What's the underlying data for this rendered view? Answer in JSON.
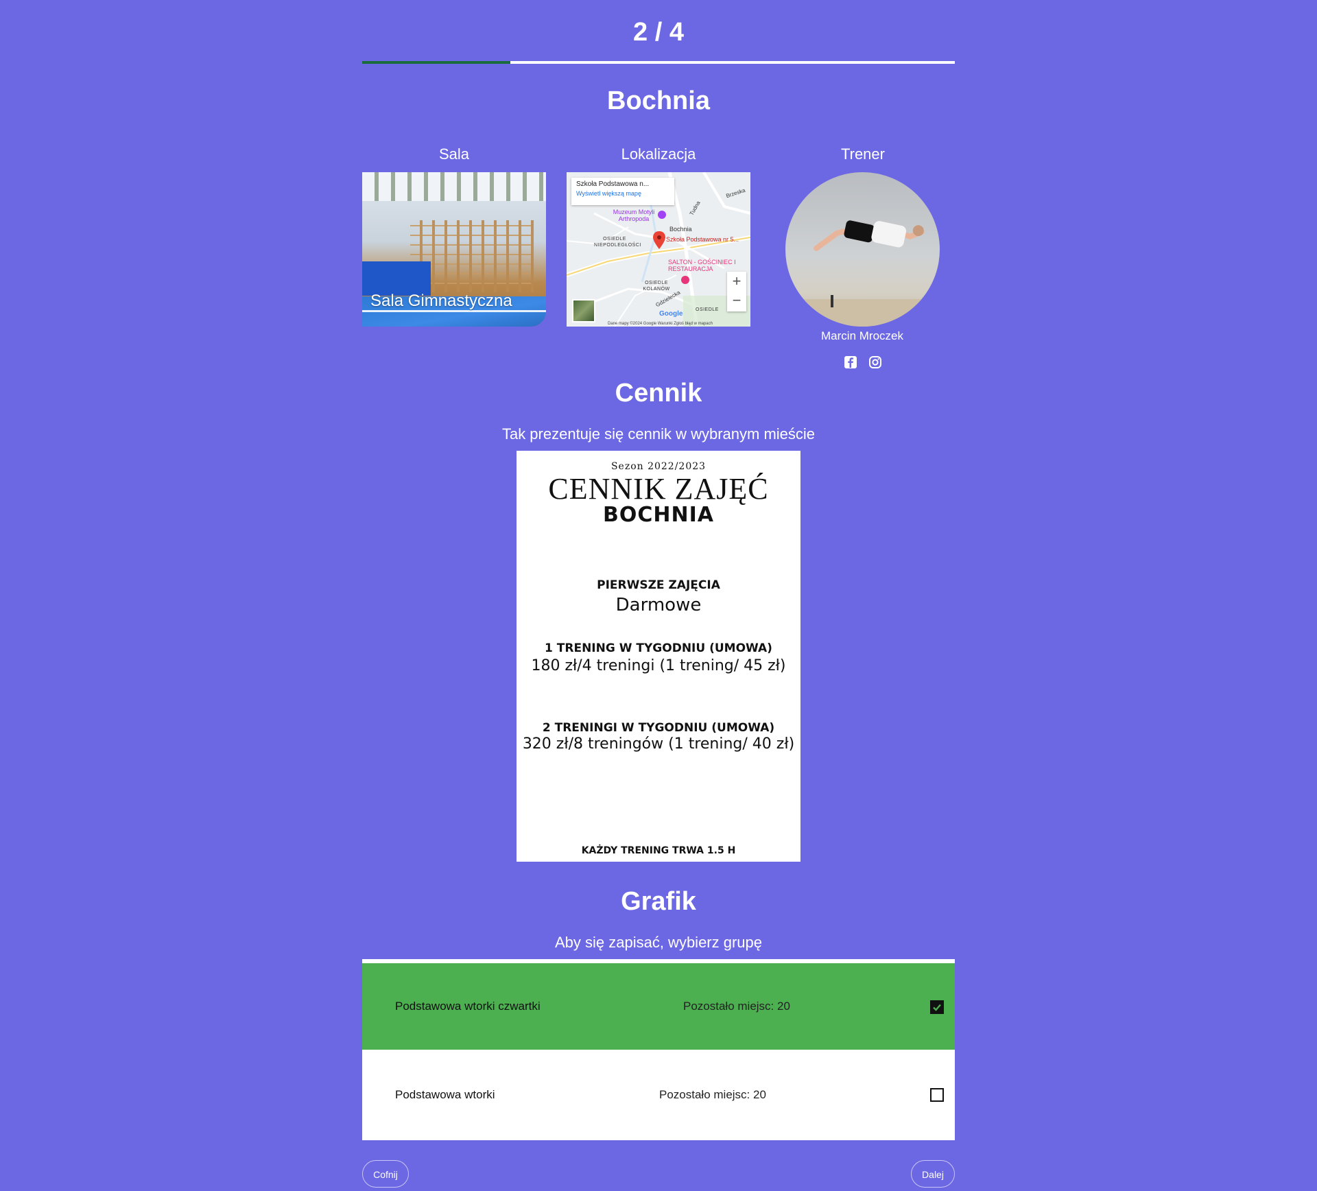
{
  "wizard": {
    "step": "2 / 4",
    "progress": 0.25
  },
  "location": {
    "city": "Bochnia"
  },
  "columns": {
    "hall_label": "Sala",
    "map_label": "Lokalizacja",
    "coach_label": "Trener"
  },
  "hall": {
    "caption": "Sala Gimnastyczna"
  },
  "map": {
    "card_title": "Szkoła Podstawowa n...",
    "card_link": "Wyświetl większą mapę",
    "labels": {
      "museum": "Muzeum Motyli Arthropoda",
      "city": "Bochnia",
      "school": "Szkoła Podstawowa nr 5...",
      "estate1": "OSIEDLE NIEPODLEGŁOŚCI",
      "estate2": "OSIEDLE KOLANÓW",
      "estate3": "OSIEDLE",
      "restaurant": "SALTON - GOŚCINIEC I RESTAURACJA",
      "road1": "Brzeska",
      "road2": "Tudna",
      "road3": "Gdzielecka",
      "brand": "Google"
    },
    "zoom_in": "+",
    "zoom_out": "−",
    "footer": "Dane mapy ©2024 Google   Warunki   Zgłoś błąd w mapach"
  },
  "coach": {
    "name": "Marcin Mroczek",
    "social": [
      {
        "icon": "facebook-icon"
      },
      {
        "icon": "instagram-icon"
      }
    ]
  },
  "pricing": {
    "title": "Cennik",
    "subtitle": "Tak prezentuje się cennik w wybranym mieście",
    "sheet": {
      "season": "Sezon 2022/2023",
      "heading": "CENNIK ZAJĘĆ",
      "city": "BOCHNIA",
      "first_label": "PIERWSZE ZAJĘCIA",
      "first_value": "Darmowe",
      "plan1_label": "1 TRENING W TYGODNIU (UMOWA)",
      "plan1_value": "180 zł/4 treningi  (1 trening/ 45 zł)",
      "plan2_label": "2 TRENINGI W TYGODNIU (UMOWA)",
      "plan2_value": "320 zł/8 treningów  (1 trening/ 40 zł)",
      "footer": "KAŻDY TRENING TRWA 1.5 H"
    }
  },
  "schedule": {
    "title": "Grafik",
    "subtitle": "Aby się zapisać, wybierz grupę",
    "groups": [
      {
        "name": "Podstawowa wtorki czwartki",
        "places": "Pozostało miejsc: 20",
        "selected": true
      },
      {
        "name": "Podstawowa wtorki",
        "places": "Pozostało miejsc: 20",
        "selected": false
      }
    ]
  },
  "nav": {
    "back": "Cofnij",
    "next": "Dalej"
  },
  "colors": {
    "background": "#6c67e3",
    "progress_fill": "#1a6b3c",
    "selected_row": "#4caf50"
  }
}
